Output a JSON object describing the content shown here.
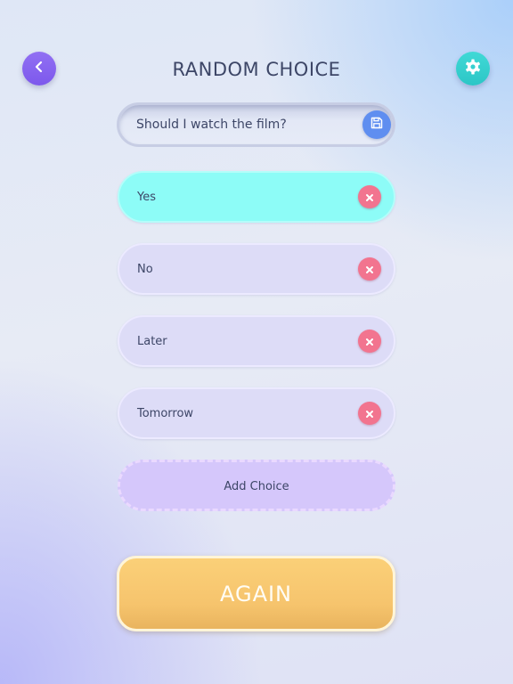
{
  "header": {
    "title": "RANDOM CHOICE",
    "back_icon": "chevron-left-icon",
    "settings_icon": "gear-icon"
  },
  "question": {
    "value": "Should I watch the film?",
    "save_icon": "save-icon"
  },
  "choices": [
    {
      "label": "Yes",
      "selected": true
    },
    {
      "label": "No",
      "selected": false
    },
    {
      "label": "Later",
      "selected": false
    },
    {
      "label": "Tomorrow",
      "selected": false
    }
  ],
  "add_choice": {
    "label": "Add Choice"
  },
  "again": {
    "label": "AGAIN"
  },
  "colors": {
    "back_button": "#8562ee",
    "settings_button": "#36cfcf",
    "selected_choice": "#8dfcf7",
    "choice": "#dddcf7",
    "remove_button": "#f2748f",
    "add_choice": "#d5c7fb",
    "again_button": "#f8c86f",
    "save_button": "#5f8ef0"
  }
}
